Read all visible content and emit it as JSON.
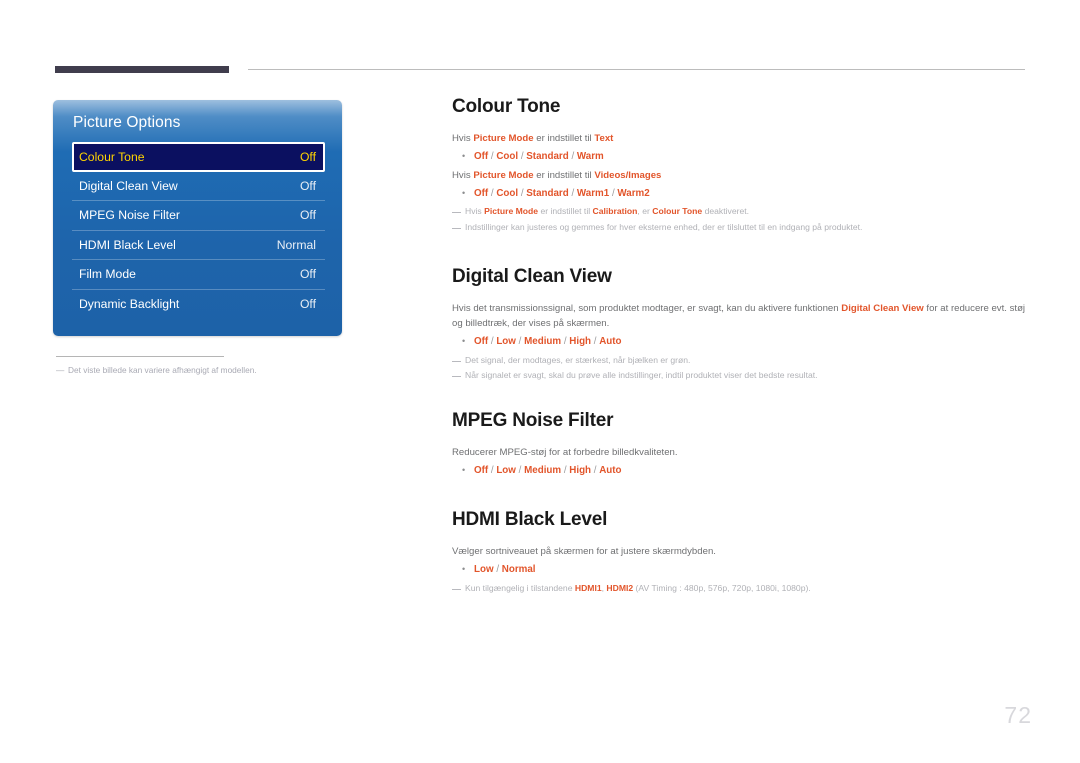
{
  "header": {
    "rule_label": "section-rule"
  },
  "osd": {
    "title": "Picture Options",
    "rows": [
      {
        "label": "Colour Tone",
        "value": "Off",
        "selected": true
      },
      {
        "label": "Digital Clean View",
        "value": "Off",
        "selected": false
      },
      {
        "label": "MPEG Noise Filter",
        "value": "Off",
        "selected": false
      },
      {
        "label": "HDMI Black Level",
        "value": "Normal",
        "selected": false
      },
      {
        "label": "Film Mode",
        "value": "Off",
        "selected": false
      },
      {
        "label": "Dynamic Backlight",
        "value": "Off",
        "selected": false
      }
    ],
    "footnote": "Det viste billede kan variere afhængigt af modellen."
  },
  "sections": {
    "colour_tone": {
      "heading": "Colour Tone",
      "line1_a": "Hvis ",
      "line1_b": "Picture Mode",
      "line1_c": " er indstillet til ",
      "line1_d": "Text",
      "bullet1": "Off / Cool / Standard / Warm",
      "line2_a": "Hvis ",
      "line2_b": "Picture Mode",
      "line2_c": " er indstillet til ",
      "line2_d": "Videos/Images",
      "bullet2": "Off / Cool / Standard / Warm1 / Warm2",
      "note1_a": "Hvis ",
      "note1_b": "Picture Mode",
      "note1_c": " er indstillet til ",
      "note1_d": "Calibration",
      "note1_e": ", er ",
      "note1_f": "Colour Tone",
      "note1_g": " deaktiveret.",
      "note2": "Indstillinger kan justeres og gemmes for hver eksterne enhed, der er tilsluttet til en indgang på produktet."
    },
    "digital_clean_view": {
      "heading": "Digital Clean View",
      "body_a": "Hvis det transmissionssignal, som produktet modtager, er svagt, kan du aktivere funktionen ",
      "body_b": "Digital Clean View",
      "body_c": " for at reducere evt. støj og billedtræk, der vises på skærmen.",
      "bullet": "Off / Low / Medium / High / Auto",
      "note1": "Det signal, der modtages, er stærkest, når bjælken er grøn.",
      "note2": "Når signalet er svagt, skal du prøve alle indstillinger, indtil produktet viser det bedste resultat."
    },
    "mpeg_noise_filter": {
      "heading": "MPEG Noise Filter",
      "body": "Reducerer MPEG-støj for at forbedre billedkvaliteten.",
      "bullet": "Off / Low / Medium / High / Auto"
    },
    "hdmi_black_level": {
      "heading": "HDMI Black Level",
      "body": "Vælger sortniveauet på skærmen for at justere skærmdybden.",
      "bullet": "Low / Normal",
      "note_a": "Kun tilgængelig i tilstandene ",
      "note_b": "HDMI1",
      "note_c": ", ",
      "note_d": "HDMI2",
      "note_e": " (AV Timing : 480p, 576p, 720p, 1080i, 1080p)."
    }
  },
  "page_number": "72",
  "colors": {
    "accent": "#e2552b",
    "osd_blue": "#1f6cb4",
    "osd_selected_bg": "#0b1060",
    "osd_selected_text": "#ffd400",
    "header_bar": "#403d4d"
  },
  "icons": {
    "bullet": "•",
    "note_dash": "—"
  }
}
